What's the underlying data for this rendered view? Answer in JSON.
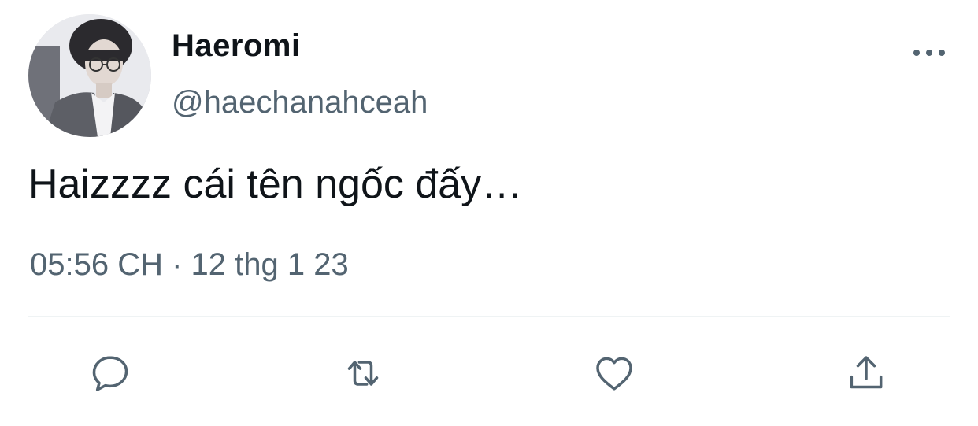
{
  "author": {
    "display_name": "Haeromi",
    "handle": "@haechanahceah",
    "avatar_icon": "profile-photo"
  },
  "tweet": {
    "text": "Haizzzz cái tên ngốc đấy…",
    "timestamp": "05:56 CH · 12 thg 1 23"
  },
  "actions": [
    {
      "name": "reply",
      "icon": "reply-icon"
    },
    {
      "name": "retweet",
      "icon": "retweet-icon"
    },
    {
      "name": "like",
      "icon": "heart-icon"
    },
    {
      "name": "share",
      "icon": "share-icon"
    }
  ],
  "colors": {
    "text": "#0f1419",
    "secondary": "#536471",
    "divider": "#eff3f4"
  }
}
